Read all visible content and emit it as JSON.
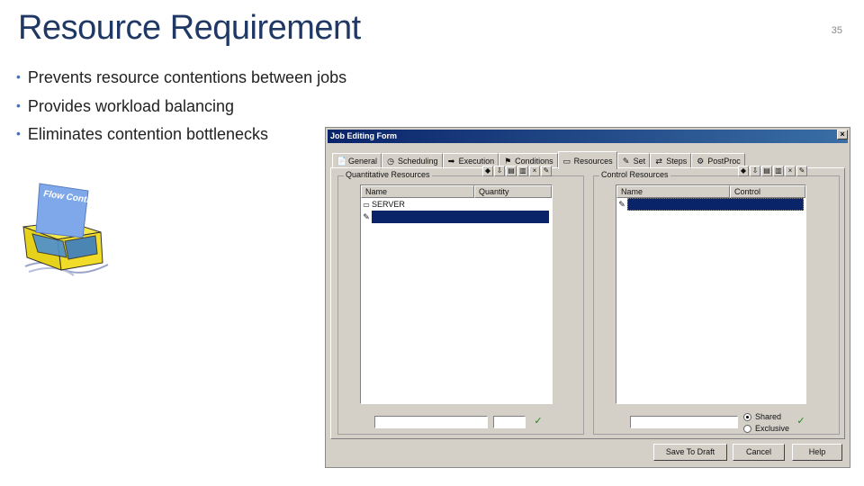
{
  "slide": {
    "title": "Resource Requirement",
    "number": "35",
    "bullets": [
      "Prevents resource contentions between jobs",
      "Provides workload balancing",
      "Eliminates contention bottlenecks"
    ],
    "graphic_label": "Flow Control"
  },
  "dialog": {
    "title": "Job Editing Form",
    "close_glyph": "×",
    "tabs": [
      {
        "label": "General",
        "icon": "📄"
      },
      {
        "label": "Scheduling",
        "icon": "◷"
      },
      {
        "label": "Execution",
        "icon": "➡"
      },
      {
        "label": "Conditions",
        "icon": "⚑"
      },
      {
        "label": "Resources",
        "icon": "▭"
      },
      {
        "label": "Set",
        "icon": "✎"
      },
      {
        "label": "Steps",
        "icon": "⇄"
      },
      {
        "label": "PostProc",
        "icon": "⚙"
      }
    ],
    "active_tab": "Resources",
    "quantitative": {
      "legend": "Quantitative Resources",
      "columns": [
        "Name",
        "Quantity"
      ],
      "rows": [
        {
          "name": "SERVER",
          "quantity": ""
        }
      ],
      "name_value": "",
      "quantity_value": ""
    },
    "control": {
      "legend": "Control Resources",
      "columns": [
        "Name",
        "Control"
      ],
      "name_value": "",
      "options": [
        "Shared",
        "Exclusive"
      ],
      "selected_option": "Shared"
    },
    "toolbar_icons": [
      "◆",
      "⇩",
      "▤",
      "▥",
      "×",
      "✎"
    ],
    "buttons": {
      "save": "Save To Draft",
      "cancel": "Cancel",
      "help": "Help"
    },
    "apply_glyph": "✓"
  },
  "colors": {
    "title": "#1f3864",
    "bullet": "#4472c4",
    "selection": "#0a246a",
    "dialog_bg": "#d4d0c8"
  }
}
